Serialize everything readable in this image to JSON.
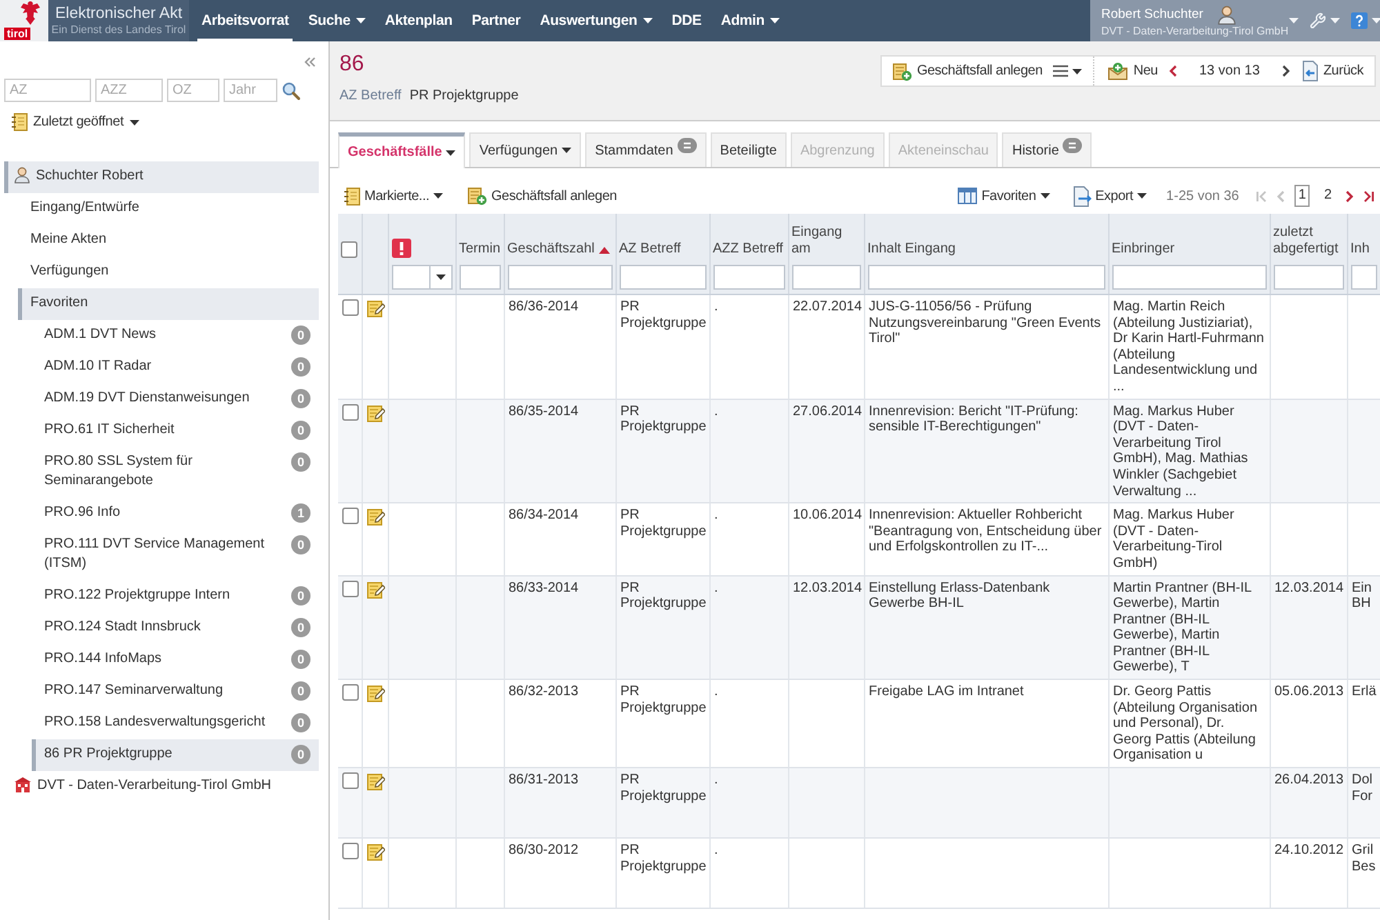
{
  "app_header": {
    "logo_text": "tirol",
    "title": "Elektronischer Akt",
    "subtitle": "Ein Dienst des Landes Tirol",
    "nav": [
      {
        "label": "Arbeitsvorrat",
        "selected": true,
        "dropdown": false
      },
      {
        "label": "Suche",
        "selected": false,
        "dropdown": true
      },
      {
        "label": "Aktenplan",
        "selected": false,
        "dropdown": false
      },
      {
        "label": "Partner",
        "selected": false,
        "dropdown": false
      },
      {
        "label": "Auswertungen",
        "selected": false,
        "dropdown": true
      },
      {
        "label": "DDE",
        "selected": false,
        "dropdown": false
      },
      {
        "label": "Admin",
        "selected": false,
        "dropdown": true
      }
    ],
    "user": {
      "name": "Robert Schuchter",
      "organization": "DVT - Daten-Verarbeitung-Tirol GmbH"
    }
  },
  "sidebar": {
    "search_fields": [
      {
        "placeholder": "AZ"
      },
      {
        "placeholder": "AZZ"
      },
      {
        "placeholder": "OZ"
      },
      {
        "placeholder": "Jahr"
      }
    ],
    "recent_menu": "Zuletzt geöffnet",
    "tree": [
      {
        "kind": "user",
        "label": "Schuchter Robert",
        "active": true,
        "children": [
          {
            "label": "Eingang/Entwürfe",
            "active": false
          },
          {
            "label": "Meine Akten",
            "active": false
          },
          {
            "label": "Verfügungen",
            "active": false
          },
          {
            "label": "Favoriten",
            "active": true,
            "children": [
              {
                "label": "ADM.1 DVT News",
                "count": "0",
                "active": false
              },
              {
                "label": "ADM.10 IT Radar",
                "count": "0",
                "active": false
              },
              {
                "label": "ADM.19 DVT Dienstanweisungen",
                "count": "0",
                "active": false
              },
              {
                "label": "PRO.61 IT Sicherheit",
                "count": "0",
                "active": false
              },
              {
                "label": "PRO.80 SSL System für Seminarangebote",
                "count": "0",
                "active": false
              },
              {
                "label": "PRO.96 Info",
                "count": "1",
                "active": false
              },
              {
                "label": "PRO.111 DVT Service Management (ITSM)",
                "count": "0",
                "active": false
              },
              {
                "label": "PRO.122 Projektgruppe Intern",
                "count": "0",
                "active": false
              },
              {
                "label": "PRO.124 Stadt Innsbruck",
                "count": "0",
                "active": false
              },
              {
                "label": "PRO.144 InfoMaps",
                "count": "0",
                "active": false
              },
              {
                "label": "PRO.147 Seminarverwaltung",
                "count": "0",
                "active": false
              },
              {
                "label": "PRO.158 Landesverwaltungsgericht",
                "count": "0",
                "active": false
              },
              {
                "label": "86 PR Projektgruppe",
                "count": "0",
                "active": true
              }
            ]
          }
        ]
      },
      {
        "kind": "organization",
        "label": "DVT - Daten-Verarbeitung-Tirol GmbH",
        "active": false
      }
    ]
  },
  "case_header": {
    "number": "86",
    "fields": [
      {
        "label": "AZ Betreff",
        "value": "PR Projektgruppe"
      }
    ]
  },
  "case_toolbar": {
    "create_button": "Geschäftsfall anlegen",
    "new_button": "Neu",
    "position": "13 von 13",
    "back_button": "Zurück"
  },
  "tabs": [
    {
      "label": "Geschäftsfälle",
      "selected": true,
      "disabled": false,
      "dropdown": true,
      "badge": false
    },
    {
      "label": "Verfügungen",
      "selected": false,
      "disabled": false,
      "dropdown": true,
      "badge": false
    },
    {
      "label": "Stammdaten",
      "selected": false,
      "disabled": false,
      "dropdown": false,
      "badge": true
    },
    {
      "label": "Beteiligte",
      "selected": false,
      "disabled": false,
      "dropdown": false,
      "badge": false
    },
    {
      "label": "Abgrenzung",
      "selected": false,
      "disabled": true,
      "dropdown": false,
      "badge": false
    },
    {
      "label": "Akteneinschau",
      "selected": false,
      "disabled": true,
      "dropdown": false,
      "badge": false
    },
    {
      "label": "Historie",
      "selected": false,
      "disabled": false,
      "dropdown": false,
      "badge": true
    }
  ],
  "grid_toolbar": {
    "marked_menu": "Markierte...",
    "create_button": "Geschäftsfall anlegen",
    "favorites_menu": "Favoriten",
    "export_menu": "Export",
    "range": "1-25 von 36",
    "pager": [
      {
        "kind": "first",
        "disabled": true
      },
      {
        "kind": "prev",
        "disabled": true
      },
      {
        "kind": "page",
        "label": "1",
        "selected": true
      },
      {
        "kind": "page",
        "label": "2",
        "selected": false
      },
      {
        "kind": "next",
        "disabled": false
      },
      {
        "kind": "last",
        "disabled": false
      }
    ]
  },
  "table": {
    "columns": [
      {
        "kind": "checkbox",
        "checked": false
      },
      {
        "kind": "icon"
      },
      {
        "kind": "priority"
      },
      {
        "kind": "text",
        "label": "Termin",
        "sorted": false
      },
      {
        "kind": "text",
        "label": "Geschäftszahl",
        "sorted": true
      },
      {
        "kind": "text",
        "label": "AZ Betreff",
        "sorted": false
      },
      {
        "kind": "text",
        "label": "AZZ Betreff",
        "sorted": false
      },
      {
        "kind": "text",
        "label": "Eingang am",
        "sorted": false
      },
      {
        "kind": "text",
        "label": "Inhalt Eingang",
        "sorted": false
      },
      {
        "kind": "text",
        "label": "Einbringer",
        "sorted": false
      },
      {
        "kind": "text",
        "label": "zuletzt abgefertigt",
        "sorted": false
      },
      {
        "kind": "text",
        "label": "Inh",
        "sorted": false
      }
    ],
    "rows": [
      {
        "checked": false,
        "geschaeftszahl": "86/36-2014",
        "az_betreff": "PR Projektgruppe",
        "azz_betreff": ".",
        "eingang_am": "22.07.2014",
        "inhalt_eingang": "JUS-G-11056/56 - Prüfung Nutzungsvereinbarung \"Green Events Tirol\"",
        "einbringer": "Mag. Martin Reich (Abteilung Justiziariat), Dr Karin Hartl-Fuhrmann (Abteilung Landesentwicklung und ..."
      },
      {
        "checked": false,
        "geschaeftszahl": "86/35-2014",
        "az_betreff": "PR Projektgruppe",
        "azz_betreff": ".",
        "eingang_am": "27.06.2014",
        "inhalt_eingang": "Innenrevision: Bericht \"IT-Prüfung: sensible IT-Berechtigungen\"",
        "einbringer": "Mag. Markus Huber (DVT - Daten-Verarbeitung Tirol GmbH), Mag. Mathias Winkler (Sachgebiet Verwaltung ..."
      },
      {
        "checked": false,
        "geschaeftszahl": "86/34-2014",
        "az_betreff": "PR Projektgruppe",
        "azz_betreff": ".",
        "eingang_am": "10.06.2014",
        "inhalt_eingang": "Innenrevision: Aktueller Rohbericht \"Beantragung von, Entscheidung über und Erfolgskontrollen zu IT-...",
        "einbringer": "Mag. Markus Huber (DVT - Daten-Verarbeitung-Tirol GmbH)"
      },
      {
        "checked": false,
        "geschaeftszahl": "86/33-2014",
        "az_betreff": "PR Projektgruppe",
        "azz_betreff": ".",
        "eingang_am": "12.03.2014",
        "inhalt_eingang": "Einstellung Erlass-Datenbank Gewerbe BH-IL",
        "einbringer": "Martin Prantner (BH-IL Gewerbe), Martin Prantner (BH-IL Gewerbe), Martin Prantner (BH-IL Gewerbe), T",
        "zuletzt_abgefertigt": "12.03.2014",
        "column_12": "Ein BH"
      },
      {
        "checked": false,
        "geschaeftszahl": "86/32-2013",
        "az_betreff": "PR Projektgruppe",
        "azz_betreff": ".",
        "inhalt_eingang": "Freigabe LAG im Intranet",
        "einbringer": "Dr. Georg Pattis (Abteilung Organisation und Personal), Dr. Georg Pattis (Abteilung Organisation u",
        "zuletzt_abgefertigt": "05.06.2013",
        "column_12": "Erlä"
      },
      {
        "checked": false,
        "geschaeftszahl": "86/31-2013",
        "az_betreff": "PR Projektgruppe",
        "azz_betreff": ".",
        "zuletzt_abgefertigt": "26.04.2013",
        "column_12": "Dol For"
      },
      {
        "checked": false,
        "geschaeftszahl": "86/30-2012",
        "az_betreff": "PR Projektgruppe",
        "azz_betreff": ".",
        "zuletzt_abgefertigt": "24.10.2012",
        "column_12": "Gril Bes"
      }
    ]
  }
}
